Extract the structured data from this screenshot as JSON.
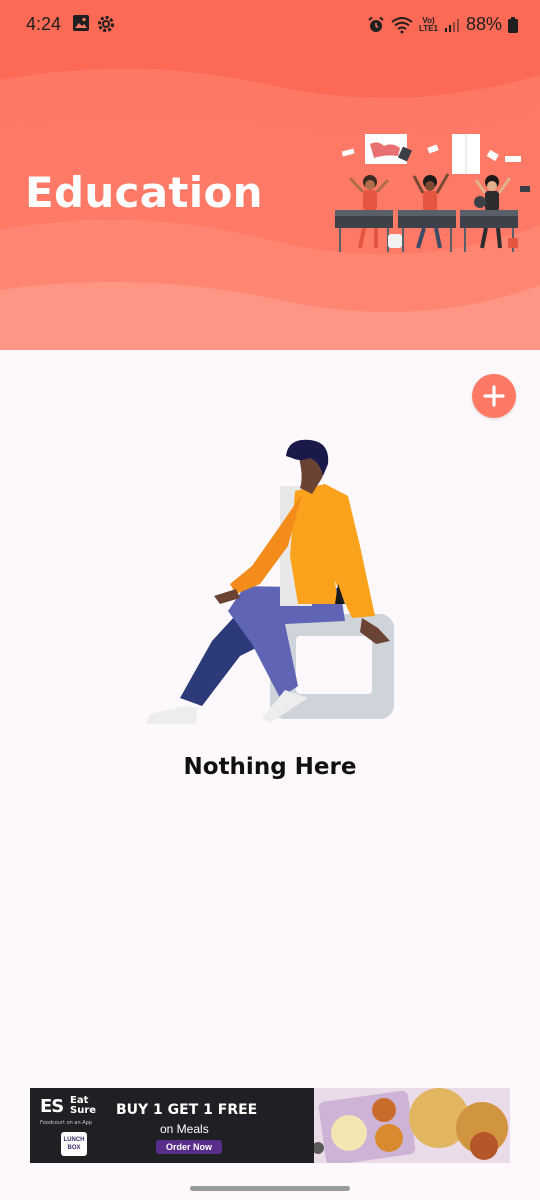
{
  "status_bar": {
    "time": "4:24",
    "battery": "88%",
    "icons_left": [
      "image-icon",
      "settings-gear-icon"
    ],
    "icons_right": [
      "alarm-icon",
      "wifi-icon",
      "volte-icon",
      "signal-icon",
      "battery-icon"
    ],
    "volte_label": "Vo)",
    "lte_label": "LTE1"
  },
  "header": {
    "title": "Education",
    "background_color": "#fd7865",
    "illustration": "classroom-students-illustration"
  },
  "fab": {
    "icon": "plus-icon",
    "color": "#fd7865"
  },
  "empty_state": {
    "illustration": "person-sitting-illustration",
    "message": "Nothing Here"
  },
  "ad": {
    "brand_mark": "ES",
    "brand_name_1": "Eat",
    "brand_name_2": "Sure",
    "brand_tagline": "Foodcourt on an App",
    "sub_brand_1": "LUNCH",
    "sub_brand_2": "BOX",
    "headline": "BUY 1 GET 1 FREE",
    "subline": "on Meals",
    "cta": "Order Now"
  }
}
